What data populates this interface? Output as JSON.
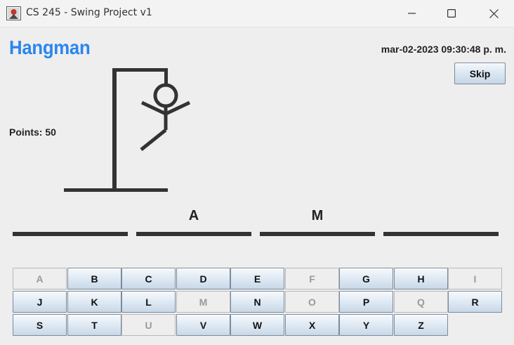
{
  "window": {
    "title": "CS 245 - Swing Project v1",
    "icon": "java-app-icon",
    "controls": [
      "minimize-icon",
      "maximize-icon",
      "close-icon"
    ]
  },
  "header": {
    "title": "Hangman",
    "title_color": "#2b86ef",
    "datetime": "mar-02-2023 09:30:48 p. m."
  },
  "skip_label": "Skip",
  "score": {
    "label": "Points:",
    "value": "50"
  },
  "hangman": {
    "parts_shown": [
      "head",
      "body",
      "left-arm",
      "right-arm",
      "left-leg"
    ]
  },
  "word": [
    "",
    "A",
    "M",
    ""
  ],
  "keyboard": {
    "rows": [
      [
        {
          "letter": "A",
          "enabled": false
        },
        {
          "letter": "B",
          "enabled": true
        },
        {
          "letter": "C",
          "enabled": true
        },
        {
          "letter": "D",
          "enabled": true
        },
        {
          "letter": "E",
          "enabled": true
        },
        {
          "letter": "F",
          "enabled": false
        },
        {
          "letter": "G",
          "enabled": true
        },
        {
          "letter": "H",
          "enabled": true
        },
        {
          "letter": "I",
          "enabled": false
        }
      ],
      [
        {
          "letter": "J",
          "enabled": true
        },
        {
          "letter": "K",
          "enabled": true
        },
        {
          "letter": "L",
          "enabled": true
        },
        {
          "letter": "M",
          "enabled": false
        },
        {
          "letter": "N",
          "enabled": true
        },
        {
          "letter": "O",
          "enabled": false
        },
        {
          "letter": "P",
          "enabled": true
        },
        {
          "letter": "Q",
          "enabled": false
        },
        {
          "letter": "R",
          "enabled": true
        }
      ],
      [
        {
          "letter": "S",
          "enabled": true
        },
        {
          "letter": "T",
          "enabled": true
        },
        {
          "letter": "U",
          "enabled": false
        },
        {
          "letter": "V",
          "enabled": true
        },
        {
          "letter": "W",
          "enabled": true
        },
        {
          "letter": "X",
          "enabled": true
        },
        {
          "letter": "Y",
          "enabled": true
        },
        {
          "letter": "Z",
          "enabled": true
        }
      ]
    ]
  }
}
